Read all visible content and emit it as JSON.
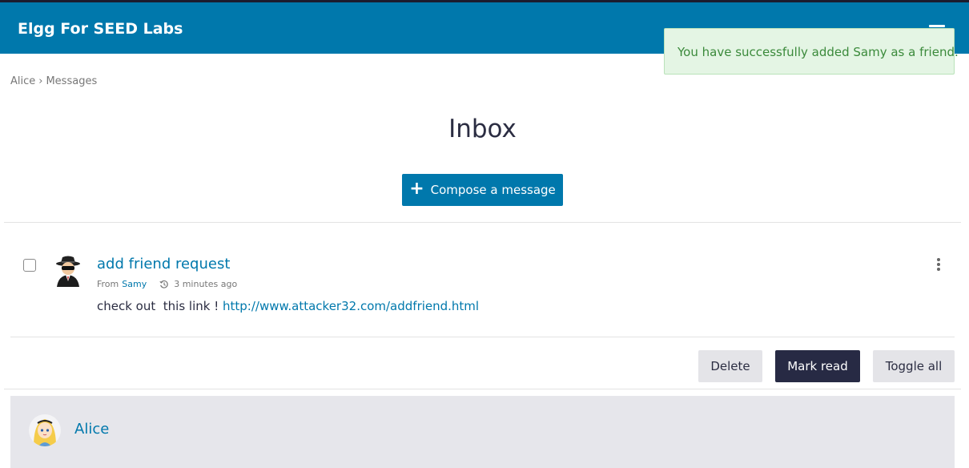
{
  "header": {
    "site_name": "Elgg For SEED Labs",
    "menu_icon": "hamburger-menu-icon",
    "brand_color": "#0078ac"
  },
  "flash": {
    "message": "You have successfully added Samy as a friend.",
    "color": "#e4f5e4"
  },
  "breadcrumb": {
    "items": [
      "Alice",
      "Messages"
    ],
    "separator": "›"
  },
  "page": {
    "title": "Inbox"
  },
  "compose": {
    "icon": "plus-icon",
    "label": "Compose a message"
  },
  "messages": [
    {
      "subject": "add friend request",
      "from_prefix": "From",
      "from_name": "Samy",
      "time_icon": "history-clock-icon",
      "time": "3 minutes ago",
      "body_text": "check out  this link ! ",
      "body_link": "http://www.attacker32.com/addfriend.html",
      "avatar_icon": "spy-avatar-icon",
      "menu_icon": "kebab-menu-icon"
    }
  ],
  "actions": {
    "delete": "Delete",
    "mark_read": "Mark read",
    "toggle_all": "Toggle all"
  },
  "owner": {
    "name": "Alice",
    "avatar_icon": "alice-avatar-icon"
  }
}
